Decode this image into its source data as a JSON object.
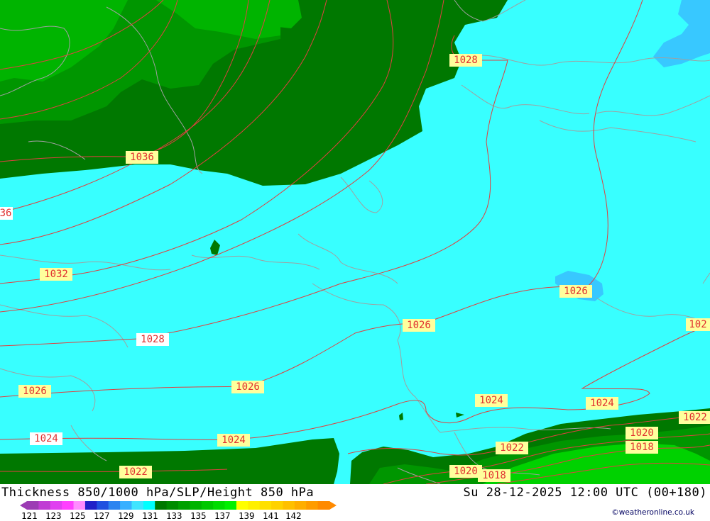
{
  "title_left": "Thickness 850/1000 hPa/SLP/Height 850 hPa",
  "title_right": "Su 28-12-2025 12:00 UTC (00+180)",
  "credit": "©weatheronline.co.uk",
  "legend": {
    "ticks": [
      "121",
      "123",
      "125",
      "127",
      "129",
      "131",
      "133",
      "135",
      "137",
      "139",
      "141",
      "142"
    ],
    "colors": [
      "#9c3cb4",
      "#c03cd4",
      "#e040f0",
      "#ff40ff",
      "#ff8cff",
      "#2020c8",
      "#2050e0",
      "#2c84f0",
      "#38b0ff",
      "#40e4ff",
      "#00ffff",
      "#007800",
      "#008c00",
      "#00a000",
      "#00b400",
      "#00c800",
      "#00dc00",
      "#00f000",
      "#ffff00",
      "#fff000",
      "#ffe000",
      "#ffd200",
      "#ffc000",
      "#ffae00",
      "#ff9c00",
      "#ff8a00"
    ]
  },
  "map": {
    "colors": {
      "cyan": "#38ffff",
      "green_dark": "#007800",
      "green_mid": "#009600",
      "green_light": "#00b400",
      "green_bright": "#00d200",
      "blue_light": "#38c8ff",
      "isobar": "#e04040",
      "coast": "#a0a0a0"
    },
    "isobar_labels": [
      {
        "text": "1028",
        "fill": "#ffff9c",
        "color": "#e03030"
      },
      {
        "text": "1036",
        "fill": "#ffff9c",
        "color": "#e03030"
      },
      {
        "text": "36",
        "fill": "#ffffff",
        "color": "#e03030"
      },
      {
        "text": "1032",
        "fill": "#ffff9c",
        "color": "#e03030"
      },
      {
        "text": "1028",
        "fill": "#ffffff",
        "color": "#e03030"
      },
      {
        "text": "1026",
        "fill": "#ffff9c",
        "color": "#e03030"
      },
      {
        "text": "1026",
        "fill": "#ffff9c",
        "color": "#e03030"
      },
      {
        "text": "1026",
        "fill": "#ffff9c",
        "color": "#e03030"
      },
      {
        "text": "1026",
        "fill": "#ffff9c",
        "color": "#e03030"
      },
      {
        "text": "102",
        "fill": "#ffff9c",
        "color": "#e03030"
      },
      {
        "text": "1024",
        "fill": "#ffff9c",
        "color": "#e03030"
      },
      {
        "text": "1024",
        "fill": "#ffff9c",
        "color": "#e03030"
      },
      {
        "text": "1024",
        "fill": "#ffffff",
        "color": "#e03030"
      },
      {
        "text": "1024",
        "fill": "#ffff9c",
        "color": "#e03030"
      },
      {
        "text": "1022",
        "fill": "#ffff9c",
        "color": "#e03030"
      },
      {
        "text": "1022",
        "fill": "#ffff9c",
        "color": "#e03030"
      },
      {
        "text": "1022",
        "fill": "#ffff9c",
        "color": "#e03030"
      },
      {
        "text": "1020",
        "fill": "#ffff9c",
        "color": "#e03030"
      },
      {
        "text": "1018",
        "fill": "#ffff9c",
        "color": "#e03030"
      },
      {
        "text": "1020",
        "fill": "#ffff9c",
        "color": "#e03030"
      },
      {
        "text": "1018",
        "fill": "#ffff9c",
        "color": "#e03030"
      }
    ]
  }
}
